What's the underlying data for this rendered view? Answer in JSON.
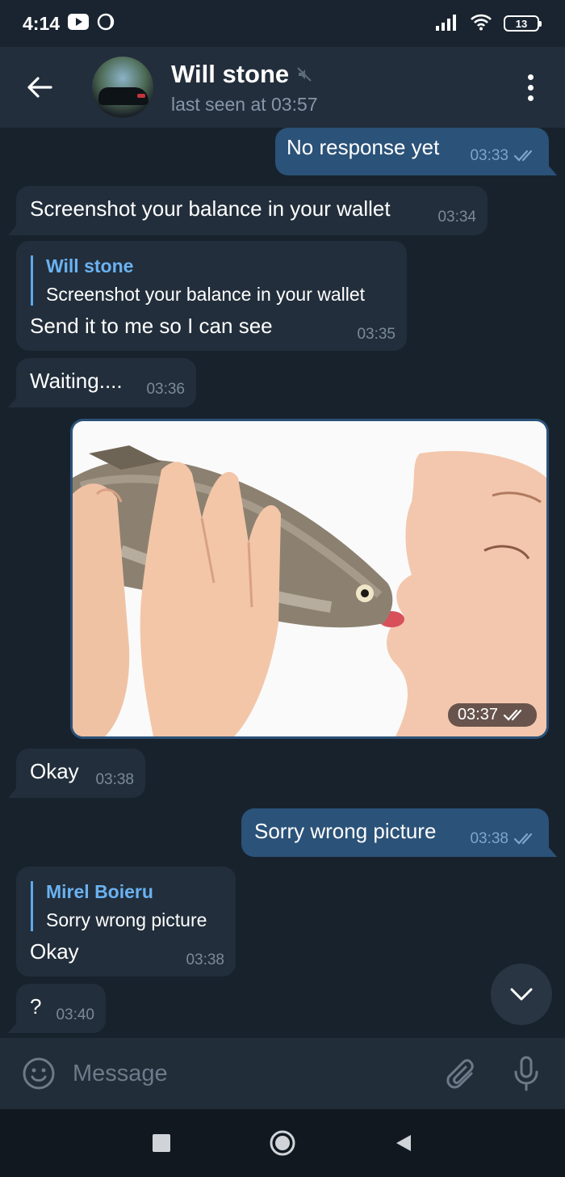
{
  "status_bar": {
    "time": "4:14",
    "battery": "13"
  },
  "header": {
    "contact_name": "Will stone",
    "last_seen": "last seen at 03:57",
    "muted": true
  },
  "messages": [
    {
      "direction": "out",
      "text": "No response yet",
      "time": "03:33",
      "status": "read"
    },
    {
      "direction": "in",
      "text": "Screenshot your balance in your wallet",
      "time": "03:34"
    },
    {
      "direction": "in",
      "reply_to": {
        "name": "Will stone",
        "text": "Screenshot your balance in your wallet"
      },
      "text": "Send it to me so I can see",
      "time": "03:35"
    },
    {
      "direction": "in",
      "text": "Waiting....",
      "time": "03:36"
    },
    {
      "direction": "out",
      "type": "photo",
      "time": "03:37",
      "status": "read"
    },
    {
      "direction": "in",
      "text": "Okay",
      "time": "03:38"
    },
    {
      "direction": "out",
      "text": "Sorry wrong picture",
      "time": "03:38",
      "status": "read"
    },
    {
      "direction": "in",
      "reply_to": {
        "name": "Mirel Boieru",
        "text": "Sorry wrong picture"
      },
      "text": "Okay",
      "time": "03:38"
    },
    {
      "direction": "in",
      "text": "?",
      "time": "03:40"
    }
  ],
  "input": {
    "placeholder": "Message"
  },
  "colors": {
    "background": "#18222d",
    "header": "#232e3c",
    "incoming_bubble": "#222e3b",
    "outgoing_bubble": "#2b5278",
    "accent": "#6ab2f2"
  },
  "icons": [
    "back-arrow-icon",
    "muted-icon",
    "more-vert-icon",
    "emoji-icon",
    "attach-icon",
    "mic-icon",
    "chevron-down-icon",
    "double-check-icon"
  ]
}
